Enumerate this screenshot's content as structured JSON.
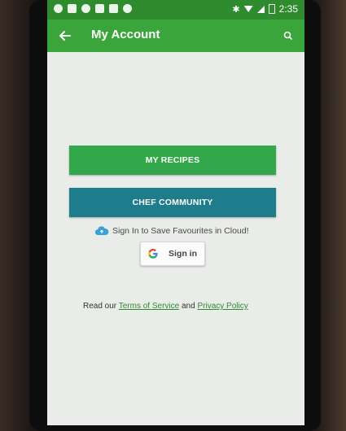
{
  "status_bar": {
    "time": "2:35"
  },
  "app_bar": {
    "title": "My Account"
  },
  "buttons": {
    "my_recipes": "MY RECIPES",
    "chef_community": "CHEF COMMUNITY"
  },
  "cloud_message": "Sign In to Save Favourites in Cloud!",
  "signin": {
    "label": "Sign in"
  },
  "legal": {
    "prefix": "Read our ",
    "terms": "Terms of Service",
    "and": " and ",
    "privacy": "Privacy Policy"
  },
  "colors": {
    "status_bar": "#2e8c2e",
    "app_bar": "#3aa53a",
    "recipes_button": "#33a84a",
    "community_button": "#1e7d8c",
    "link": "#2e8c2e"
  },
  "icons": {
    "back": "arrow-left-icon",
    "search": "search-icon",
    "cloud": "cloud-upload-icon",
    "google": "google-g-icon"
  }
}
